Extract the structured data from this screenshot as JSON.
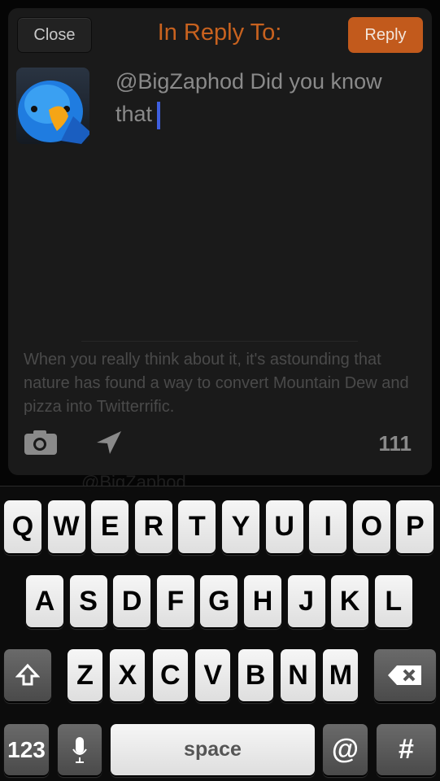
{
  "header": {
    "close_label": "Close",
    "title": "In Reply To:",
    "reply_label": "Reply"
  },
  "compose": {
    "text": "@BigZaphod Did you know that"
  },
  "quote": {
    "text": "When you really think about it, it's astounding that nature has found a way to convert Mountain Dew and pizza into Twitterrific."
  },
  "toolbar": {
    "camera_icon": "camera-icon",
    "location_icon": "location-arrow-icon",
    "char_count": "111"
  },
  "background": {
    "username": "@BigZaphod"
  },
  "keyboard": {
    "row1": [
      "Q",
      "W",
      "E",
      "R",
      "T",
      "Y",
      "U",
      "I",
      "O",
      "P"
    ],
    "row2": [
      "A",
      "S",
      "D",
      "F",
      "G",
      "H",
      "J",
      "K",
      "L"
    ],
    "row3": [
      "Z",
      "X",
      "C",
      "V",
      "B",
      "N",
      "M"
    ],
    "numbers_label": "123",
    "space_label": "space",
    "at_label": "@",
    "hash_label": "#"
  },
  "colors": {
    "accent": "#c8621f",
    "reply_button": "#c25a1c",
    "caret": "#3e5fe0"
  }
}
